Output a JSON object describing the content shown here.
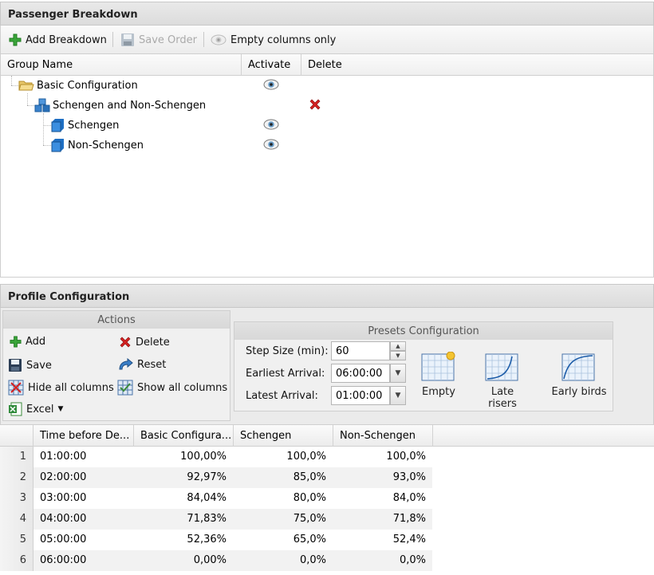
{
  "passenger": {
    "title": "Passenger Breakdown",
    "toolbar": {
      "add": "Add Breakdown",
      "save_order": "Save Order",
      "empty_cols": "Empty columns only"
    },
    "columns": [
      "Group Name",
      "Activate",
      "Delete"
    ],
    "tree": [
      {
        "label": "Basic Configuration",
        "activate": true,
        "delete": false
      },
      {
        "label": "Schengen and Non-Schengen",
        "activate": false,
        "delete": true
      },
      {
        "label": "Schengen",
        "activate": true,
        "delete": false
      },
      {
        "label": "Non-Schengen",
        "activate": true,
        "delete": false
      }
    ]
  },
  "profile": {
    "title": "Profile Configuration",
    "actions": {
      "title": "Actions",
      "add": "Add",
      "delete": "Delete",
      "save": "Save",
      "reset": "Reset",
      "hide_all": "Hide all columns",
      "show_all": "Show all columns",
      "excel": "Excel"
    },
    "presets": {
      "title": "Presets Configuration",
      "step_label": "Step Size (min):",
      "step_value": "60",
      "earliest_label": "Earliest Arrival:",
      "earliest_value": "06:00:00",
      "latest_label": "Latest Arrival:",
      "latest_value": "01:00:00",
      "buttons": [
        "Empty",
        "Late risers",
        "Early birds"
      ]
    }
  },
  "grid": {
    "columns": [
      "Time before De...",
      "Basic Configura...",
      "Schengen",
      "Non-Schengen"
    ],
    "rows": [
      {
        "n": "1",
        "time": "01:00:00",
        "basic": "100,00%",
        "schengen": "100,0%",
        "non": "100,0%"
      },
      {
        "n": "2",
        "time": "02:00:00",
        "basic": "92,97%",
        "schengen": "85,0%",
        "non": "93,0%"
      },
      {
        "n": "3",
        "time": "03:00:00",
        "basic": "84,04%",
        "schengen": "80,0%",
        "non": "84,0%"
      },
      {
        "n": "4",
        "time": "04:00:00",
        "basic": "71,83%",
        "schengen": "75,0%",
        "non": "71,8%"
      },
      {
        "n": "5",
        "time": "05:00:00",
        "basic": "52,36%",
        "schengen": "65,0%",
        "non": "52,4%"
      },
      {
        "n": "6",
        "time": "06:00:00",
        "basic": "0,00%",
        "schengen": "0,0%",
        "non": "0,0%"
      }
    ]
  },
  "colors": {
    "accent_green": "#2e9b2e",
    "delete_red": "#d42020",
    "cube_blue": "#2a7fd4"
  }
}
